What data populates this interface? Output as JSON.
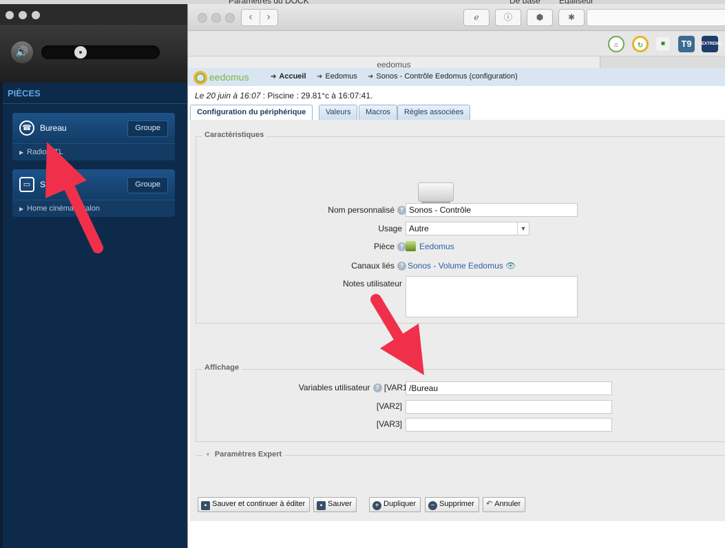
{
  "back_window": {
    "tab1": "Paramètres du DOCK",
    "tab2": "De base",
    "tab3": "Égaliseur"
  },
  "sonos": {
    "section_title": "PIÈCES",
    "rooms": [
      {
        "name": "Bureau",
        "group_label": "Groupe",
        "source": "Radio RTL",
        "icon": "radio-icon"
      },
      {
        "name": "Salon",
        "group_label": "Groupe",
        "source": "Home cinéma - Salon",
        "icon": "tv-icon"
      }
    ]
  },
  "browser": {
    "tab_title": "eedomus",
    "extensions": [
      "maps-icon",
      "refresh-circle-icon",
      "green-square-icon",
      "t9-icon",
      "extreme-icon"
    ],
    "extension_labels": {
      "t9": "T9",
      "extreme": "EXTREME"
    }
  },
  "eedomus": {
    "logo": "eedomus",
    "breadcrumb": [
      "Accueil",
      "Eedomus",
      "Sonos - Contrôle Eedomus (configuration)"
    ],
    "status": {
      "date": "Le 20 juin à 16:07",
      "rest": " : Piscine : 29.81°c à 16:07:41."
    },
    "tabs": [
      "Configuration du périphérique",
      "Valeurs",
      "Macros",
      "Règles associées"
    ],
    "caracteristiques": {
      "legend": "Caractéristiques",
      "nom_label": "Nom personnalisé",
      "nom_value": "Sonos - Contrôle",
      "usage_label": "Usage",
      "usage_value": "Autre",
      "piece_label": "Pièce",
      "piece_value": "Eedomus",
      "canaux_label": "Canaux liés",
      "canaux_value": "Sonos - Volume Eedomus",
      "notes_label": "Notes utilisateur",
      "notes_value": ""
    },
    "affichage": {
      "legend": "Affichage",
      "vars_label": "Variables utilisateur",
      "var1_label": "[VAR1]",
      "var1_value": "/Bureau",
      "var2_label": "[VAR2]",
      "var2_value": "",
      "var3_label": "[VAR3]",
      "var3_value": ""
    },
    "expert_legend": "Paramètres Expert",
    "buttons": {
      "save_continue": "Sauver et continuer à éditer",
      "save": "Sauver",
      "duplicate": "Dupliquer",
      "delete": "Supprimer",
      "cancel": "Annuler"
    }
  },
  "colors": {
    "annotation_arrow": "#f0304a",
    "sonos_bg": "#0e2a4a",
    "eedomus_link": "#2a5fa5"
  }
}
